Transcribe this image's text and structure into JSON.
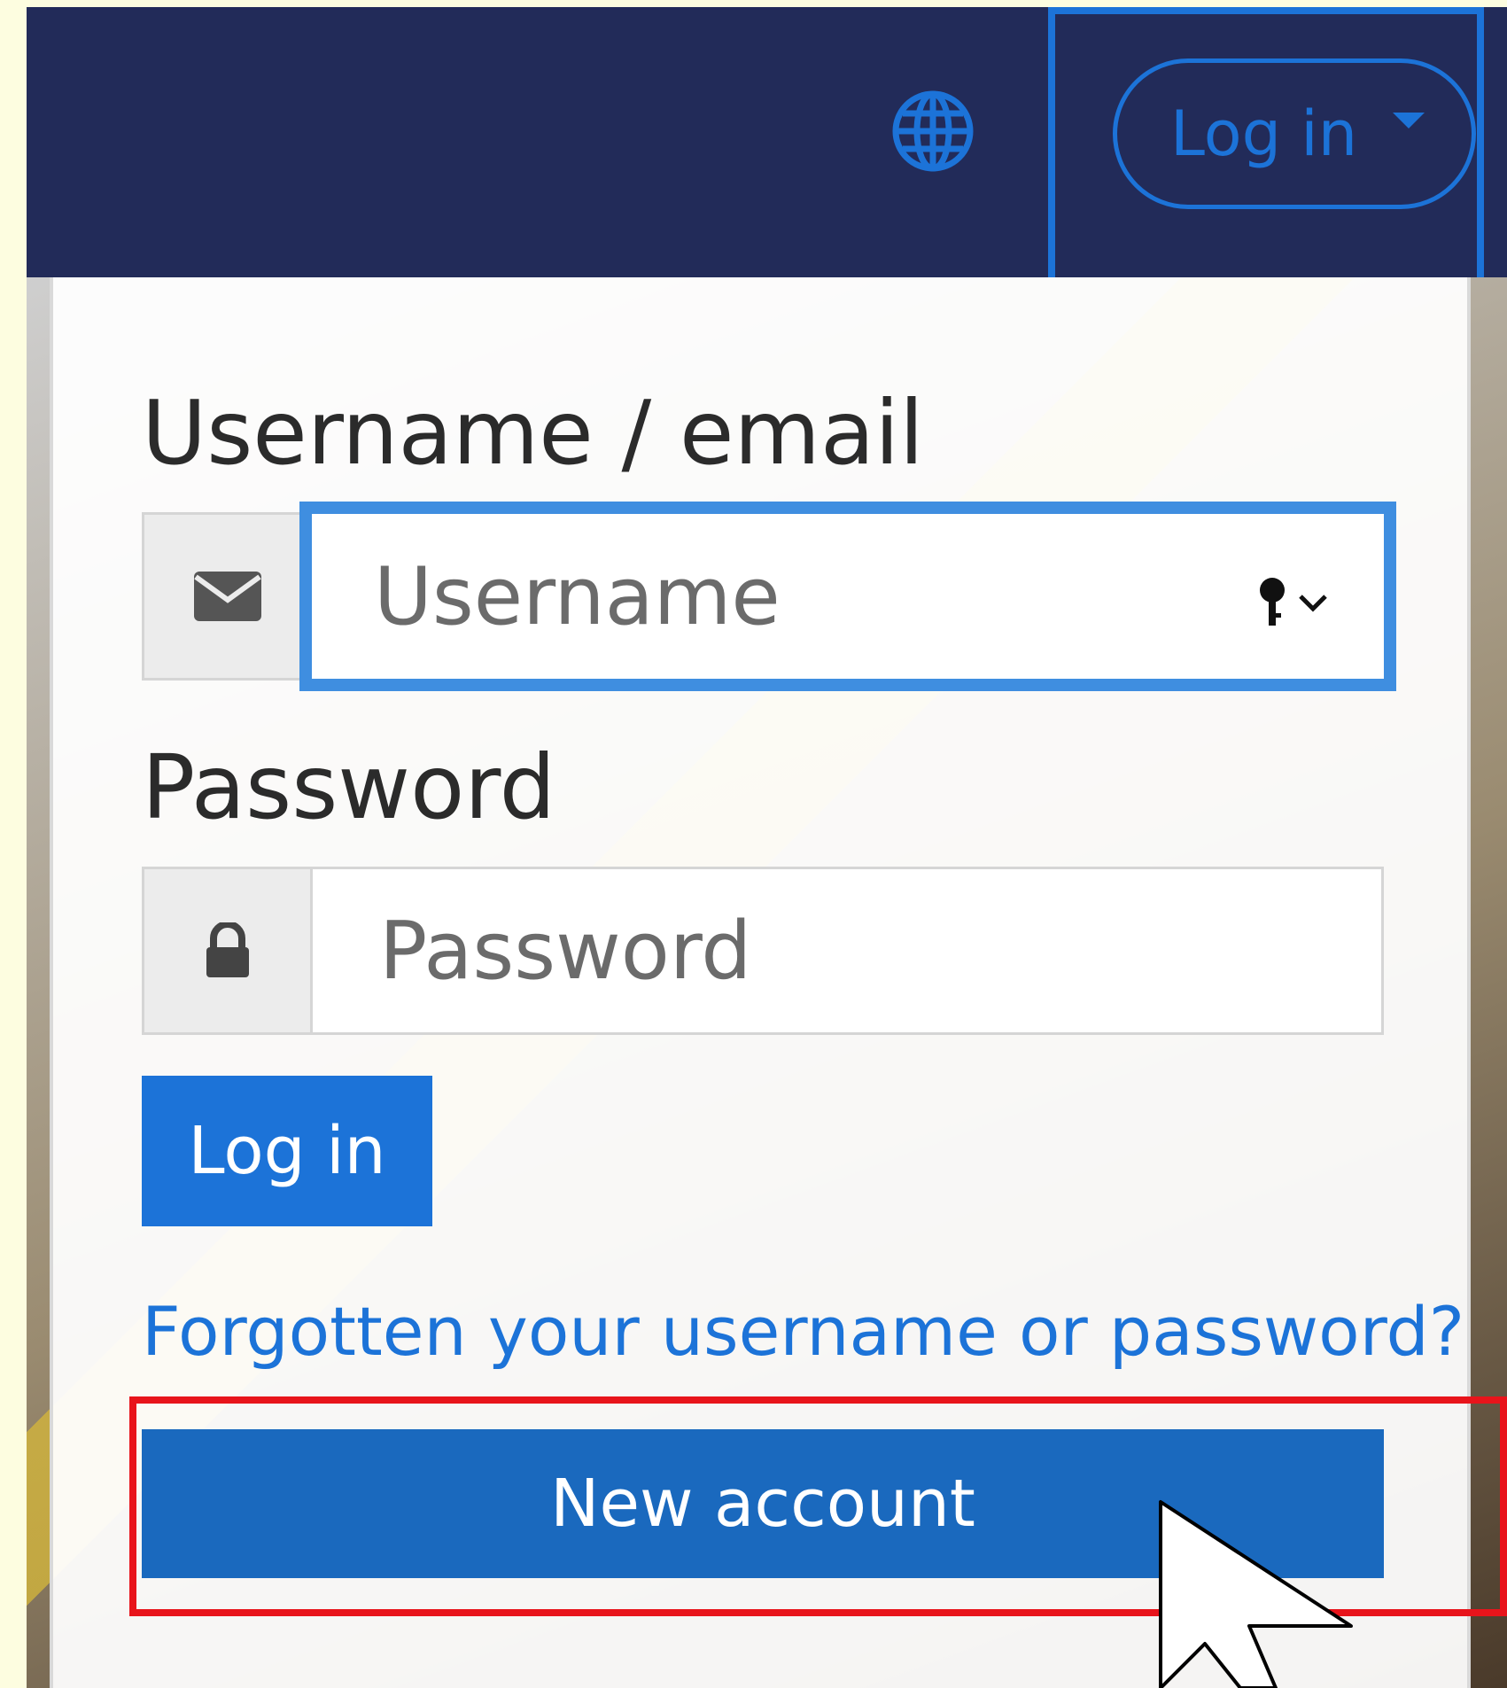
{
  "navbar": {
    "language_icon": "globe-icon",
    "login_dropdown_label": "Log in"
  },
  "login_form": {
    "username_label": "Username / email",
    "username_placeholder": "Username",
    "username_icon": "envelope-icon",
    "password_label": "Password",
    "password_placeholder": "Password",
    "password_icon": "lock-icon",
    "login_button": "Log in",
    "forgot_link": "Forgotten your username or password?",
    "new_account_button": "New account"
  },
  "colors": {
    "navbar_bg": "#222b59",
    "accent": "#1c73d8",
    "new_account_bg": "#1a69be",
    "highlight": "#e8141b"
  }
}
